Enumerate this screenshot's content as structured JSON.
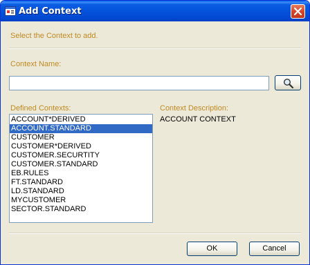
{
  "window": {
    "title": "Add Context",
    "title_icon": "app-icon",
    "close_icon": "close-icon"
  },
  "instruction": "Select the Context to add.",
  "context_name": {
    "label": "Context Name:",
    "value": "",
    "search_icon": "magnifier-icon"
  },
  "defined_contexts": {
    "label": "Defined Contexts:",
    "items": [
      "ACCOUNT*DERIVED",
      "ACCOUNT.STANDARD",
      "CUSTOMER",
      "CUSTOMER*DERIVED",
      "CUSTOMER.SECURTITY",
      "CUSTOMER.STANDARD",
      "EB.RULES",
      "FT.STANDARD",
      "LD.STANDARD",
      "MYCUSTOMER",
      "SECTOR.STANDARD"
    ],
    "selected": "ACCOUNT.STANDARD"
  },
  "context_description": {
    "label": "Context Description:",
    "value": "ACCOUNT CONTEXT"
  },
  "buttons": {
    "ok": "OK",
    "cancel": "Cancel"
  },
  "colors": {
    "label_text": "#c08a22",
    "selection": "#316ac5",
    "titlebar": "#0553dc"
  }
}
